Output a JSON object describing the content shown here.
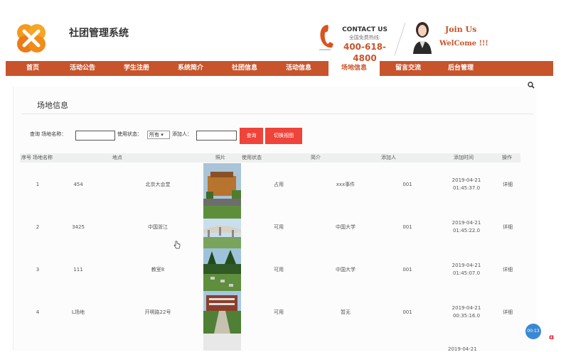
{
  "header": {
    "site_title": "社团管理系统",
    "contact_title": "CONTACT US",
    "hotline_label": "全国免费热线:",
    "phone": "400-618-4800",
    "join_line1": "Join Us",
    "join_line2": "WelCome !!!"
  },
  "nav": {
    "items": [
      {
        "label": "首页"
      },
      {
        "label": "活动公告"
      },
      {
        "label": "学生注册"
      },
      {
        "label": "系统简介"
      },
      {
        "label": "社团信息"
      },
      {
        "label": "活动信息"
      },
      {
        "label": "场地信息"
      },
      {
        "label": "留言交流"
      },
      {
        "label": "后台管理"
      }
    ],
    "active_index": 6
  },
  "page": {
    "section_title": "场地信息"
  },
  "filters": {
    "query_label": "查询 场地名称：",
    "status_label": "使用状态：",
    "status_value": "所有 ▾",
    "adder_label": "添加人：",
    "name_value": "",
    "adder_value": "",
    "query_button": "查询",
    "switch_button": "切换视图"
  },
  "table": {
    "headers": [
      "序号",
      "场地名称",
      "地点",
      "照片",
      "使用状态",
      "简介",
      "添加人",
      "添加时间",
      "操作"
    ],
    "rows": [
      {
        "index": "1",
        "name": "454",
        "location": "北京大会堂",
        "status": "占用",
        "intro": "xxx事件",
        "adder": "001",
        "date": "2019-04-21",
        "time": "01:45:37.0",
        "action": "详细"
      },
      {
        "index": "2",
        "name": "3425",
        "location": "中国浙江",
        "status": "可用",
        "intro": "中国大学",
        "adder": "001",
        "date": "2019-04-21",
        "time": "01:45:22.0",
        "action": "详细"
      },
      {
        "index": "3",
        "name": "111",
        "location": "教室8",
        "status": "可用",
        "intro": "中国大学",
        "adder": "001",
        "date": "2019-04-21",
        "time": "01:45:07.0",
        "action": "详细"
      },
      {
        "index": "4",
        "name": "L场地",
        "location": "开明路22号",
        "status": "可用",
        "intro": "暂无",
        "adder": "001",
        "date": "2019-04-21",
        "time": "00:35:16.0",
        "action": "详细"
      }
    ],
    "partial_next_date": "2019-04-21"
  },
  "widget": {
    "bubble_text": "00:13"
  },
  "colors": {
    "brand": "#c8542b",
    "button": "#f0433a"
  }
}
